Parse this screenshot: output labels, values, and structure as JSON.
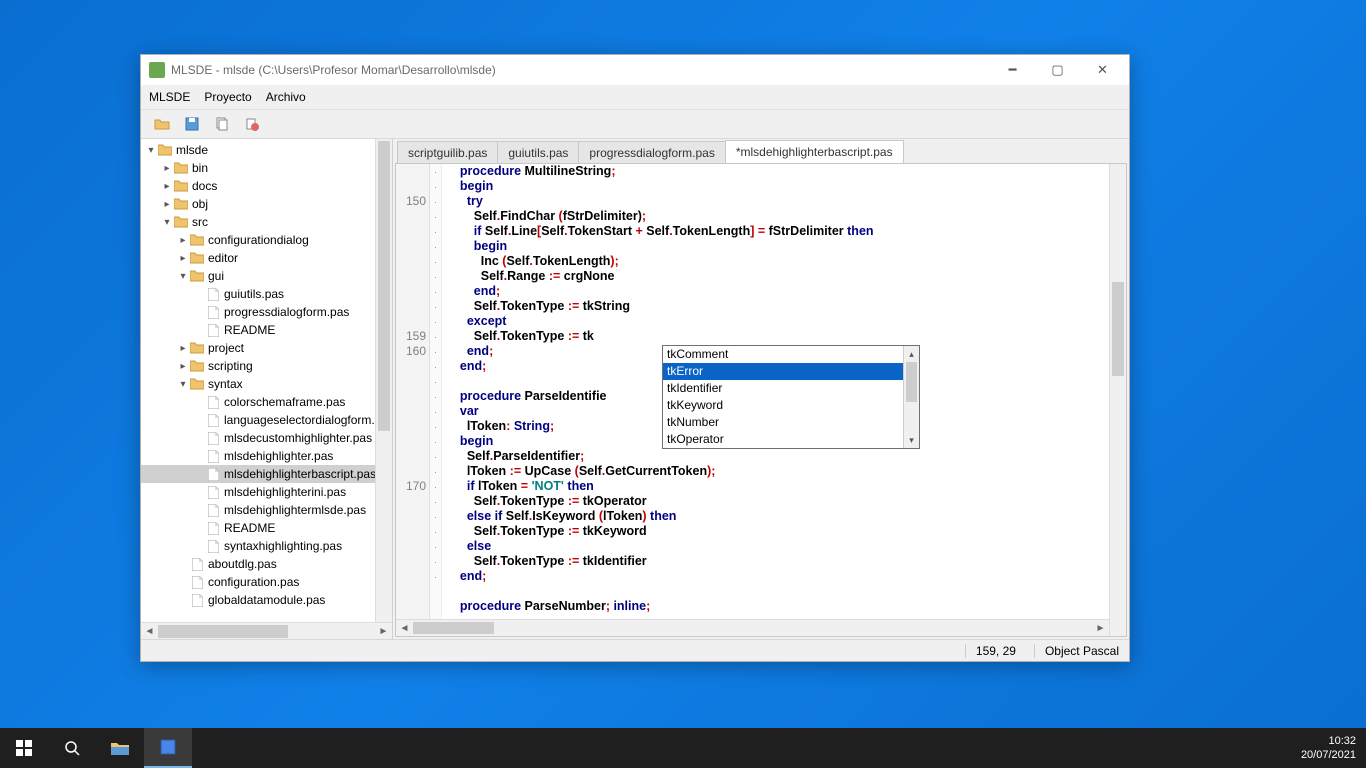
{
  "title": "MLSDE - mlsde (C:\\Users\\Profesor Momar\\Desarrollo\\mlsde)",
  "menus": [
    "MLSDE",
    "Proyecto",
    "Archivo"
  ],
  "tree": [
    {
      "d": 0,
      "t": "folder",
      "exp": "▾",
      "n": "mlsde"
    },
    {
      "d": 1,
      "t": "folder",
      "exp": "▸",
      "n": "bin"
    },
    {
      "d": 1,
      "t": "folder",
      "exp": "▸",
      "n": "docs"
    },
    {
      "d": 1,
      "t": "folder",
      "exp": "▸",
      "n": "obj"
    },
    {
      "d": 1,
      "t": "folder",
      "exp": "▾",
      "n": "src"
    },
    {
      "d": 2,
      "t": "folder",
      "exp": "▸",
      "n": "configurationdialog"
    },
    {
      "d": 2,
      "t": "folder",
      "exp": "▸",
      "n": "editor"
    },
    {
      "d": 2,
      "t": "folder",
      "exp": "▾",
      "n": "gui"
    },
    {
      "d": 3,
      "t": "file",
      "n": "guiutils.pas"
    },
    {
      "d": 3,
      "t": "file",
      "n": "progressdialogform.pas"
    },
    {
      "d": 3,
      "t": "file",
      "n": "README"
    },
    {
      "d": 2,
      "t": "folder",
      "exp": "▸",
      "n": "project"
    },
    {
      "d": 2,
      "t": "folder",
      "exp": "▸",
      "n": "scripting"
    },
    {
      "d": 2,
      "t": "folder",
      "exp": "▾",
      "n": "syntax"
    },
    {
      "d": 3,
      "t": "file",
      "n": "colorschemaframe.pas"
    },
    {
      "d": 3,
      "t": "file",
      "n": "languageselectordialogform.p"
    },
    {
      "d": 3,
      "t": "file",
      "n": "mlsdecustomhighlighter.pas"
    },
    {
      "d": 3,
      "t": "file",
      "n": "mlsdehighlighter.pas"
    },
    {
      "d": 3,
      "t": "file",
      "n": "mlsdehighlighterbascript.pas",
      "sel": true
    },
    {
      "d": 3,
      "t": "file",
      "n": "mlsdehighlighterini.pas"
    },
    {
      "d": 3,
      "t": "file",
      "n": "mlsdehighlightermlsde.pas"
    },
    {
      "d": 3,
      "t": "file",
      "n": "README"
    },
    {
      "d": 3,
      "t": "file",
      "n": "syntaxhighlighting.pas"
    },
    {
      "d": 2,
      "t": "file",
      "n": "aboutdlg.pas"
    },
    {
      "d": 2,
      "t": "file",
      "n": "configuration.pas"
    },
    {
      "d": 2,
      "t": "file",
      "n": "globaldatamodule.pas"
    }
  ],
  "tabs": [
    {
      "label": "scriptguilib.pas"
    },
    {
      "label": "guiutils.pas"
    },
    {
      "label": "progressdialogform.pas"
    },
    {
      "label": "*mlsdehighlighterbascript.pas",
      "active": true
    }
  ],
  "gutter": [
    "",
    "",
    "150",
    "",
    "",
    "",
    "",
    "",
    "",
    "",
    "",
    "159",
    "160",
    "",
    "",
    "",
    "",
    "",
    "",
    "",
    "",
    "170",
    "",
    "",
    "",
    "",
    "",
    ""
  ],
  "code_lines": [
    [
      [
        "    ",
        "sym"
      ],
      [
        "procedure ",
        "kw"
      ],
      [
        "MultilineString",
        "id"
      ],
      [
        ";",
        "sym"
      ]
    ],
    [
      [
        "    ",
        "sym"
      ],
      [
        "begin",
        "kw"
      ]
    ],
    [
      [
        "      ",
        "sym"
      ],
      [
        "try",
        "kw"
      ]
    ],
    [
      [
        "        Self",
        "id"
      ],
      [
        ".",
        "sym"
      ],
      [
        "FindChar ",
        "id"
      ],
      [
        "(",
        "sym"
      ],
      [
        "fStrDelimiter",
        "id"
      ],
      [
        ")",
        ";"
      ],
      [
        ";",
        "sym"
      ]
    ],
    [
      [
        "        ",
        "sym"
      ],
      [
        "if ",
        "kw"
      ],
      [
        "Self",
        "id"
      ],
      [
        ".",
        "sym"
      ],
      [
        "Line",
        "id"
      ],
      [
        "[",
        "sym"
      ],
      [
        "Self",
        "id"
      ],
      [
        ".",
        "sym"
      ],
      [
        "TokenStart ",
        "id"
      ],
      [
        "+ ",
        "sym"
      ],
      [
        "Self",
        "id"
      ],
      [
        ".",
        "sym"
      ],
      [
        "TokenLength",
        "id"
      ],
      [
        "] = ",
        "sym"
      ],
      [
        "fStrDelimiter ",
        "id"
      ],
      [
        "then",
        "kw"
      ]
    ],
    [
      [
        "        ",
        "sym"
      ],
      [
        "begin",
        "kw"
      ]
    ],
    [
      [
        "          Inc ",
        "id"
      ],
      [
        "(",
        "sym"
      ],
      [
        "Self",
        "id"
      ],
      [
        ".",
        "sym"
      ],
      [
        "TokenLength",
        "id"
      ],
      [
        ");",
        "sym"
      ]
    ],
    [
      [
        "          Self",
        "id"
      ],
      [
        ".",
        "sym"
      ],
      [
        "Range ",
        "id"
      ],
      [
        ":= ",
        "sym"
      ],
      [
        "crgNone",
        "id"
      ]
    ],
    [
      [
        "        ",
        "sym"
      ],
      [
        "end",
        "kw"
      ],
      [
        ";",
        "sym"
      ]
    ],
    [
      [
        "        Self",
        "id"
      ],
      [
        ".",
        "sym"
      ],
      [
        "TokenType ",
        "id"
      ],
      [
        ":= ",
        "sym"
      ],
      [
        "tkString",
        "id"
      ]
    ],
    [
      [
        "      ",
        "sym"
      ],
      [
        "except",
        "kw"
      ]
    ],
    [
      [
        "        Self",
        "id"
      ],
      [
        ".",
        "sym"
      ],
      [
        "TokenType ",
        "id"
      ],
      [
        ":= ",
        "sym"
      ],
      [
        "tk",
        "id"
      ]
    ],
    [
      [
        "      ",
        "sym"
      ],
      [
        "end",
        "kw"
      ],
      [
        ";",
        "sym"
      ]
    ],
    [
      [
        "    ",
        "sym"
      ],
      [
        "end",
        "kw"
      ],
      [
        ";",
        "sym"
      ]
    ],
    [
      [
        "",
        ""
      ]
    ],
    [
      [
        "    ",
        "sym"
      ],
      [
        "procedure ",
        "kw"
      ],
      [
        "ParseIdentifie",
        "id"
      ]
    ],
    [
      [
        "    ",
        "sym"
      ],
      [
        "var",
        "kw"
      ]
    ],
    [
      [
        "      lToken",
        "id"
      ],
      [
        ": ",
        "sym"
      ],
      [
        "String",
        "kw"
      ],
      [
        ";",
        "sym"
      ]
    ],
    [
      [
        "    ",
        "sym"
      ],
      [
        "begin",
        "kw"
      ]
    ],
    [
      [
        "      Self",
        "id"
      ],
      [
        ".",
        "sym"
      ],
      [
        "ParseIdentifier",
        "id"
      ],
      [
        ";",
        "sym"
      ]
    ],
    [
      [
        "      lToken ",
        "id"
      ],
      [
        ":= ",
        "sym"
      ],
      [
        "UpCase ",
        "id"
      ],
      [
        "(",
        "sym"
      ],
      [
        "Self",
        "id"
      ],
      [
        ".",
        "sym"
      ],
      [
        "GetCurrentToken",
        "id"
      ],
      [
        ");",
        "sym"
      ]
    ],
    [
      [
        "      ",
        "sym"
      ],
      [
        "if ",
        "kw"
      ],
      [
        "lToken ",
        "id"
      ],
      [
        "= ",
        "sym"
      ],
      [
        "'NOT'",
        "str"
      ],
      [
        " ",
        "sym"
      ],
      [
        "then",
        "kw"
      ]
    ],
    [
      [
        "        Self",
        "id"
      ],
      [
        ".",
        "sym"
      ],
      [
        "TokenType ",
        "id"
      ],
      [
        ":= ",
        "sym"
      ],
      [
        "tkOperator",
        "id"
      ]
    ],
    [
      [
        "      ",
        "sym"
      ],
      [
        "else if ",
        "kw"
      ],
      [
        "Self",
        "id"
      ],
      [
        ".",
        "sym"
      ],
      [
        "IsKeyword ",
        "id"
      ],
      [
        "(",
        "sym"
      ],
      [
        "lToken",
        "id"
      ],
      [
        ") ",
        "sym"
      ],
      [
        "then",
        "kw"
      ]
    ],
    [
      [
        "        Self",
        "id"
      ],
      [
        ".",
        "sym"
      ],
      [
        "TokenType ",
        "id"
      ],
      [
        ":= ",
        "sym"
      ],
      [
        "tkKeyword",
        "id"
      ]
    ],
    [
      [
        "      ",
        "sym"
      ],
      [
        "else",
        "kw"
      ]
    ],
    [
      [
        "        Self",
        "id"
      ],
      [
        ".",
        "sym"
      ],
      [
        "TokenType ",
        "id"
      ],
      [
        ":= ",
        "sym"
      ],
      [
        "tkIdentifier",
        "id"
      ]
    ],
    [
      [
        "    ",
        "sym"
      ],
      [
        "end",
        "kw"
      ],
      [
        ";",
        "sym"
      ]
    ],
    [
      [
        "",
        ""
      ]
    ],
    [
      [
        "    ",
        "sym"
      ],
      [
        "procedure ",
        "kw"
      ],
      [
        "ParseNumber",
        "id"
      ],
      [
        "; ",
        "sym"
      ],
      [
        "inline",
        "kw"
      ],
      [
        ";",
        "sym"
      ]
    ]
  ],
  "autocomplete": {
    "items": [
      "tkComment",
      "tkError",
      "tkIdentifier",
      "tkKeyword",
      "tkNumber",
      "tkOperator"
    ],
    "selected": 1
  },
  "status": {
    "pos": "159, 29",
    "lang": "Object Pascal"
  },
  "taskbar": {
    "time": "10:32",
    "date": "20/07/2021"
  }
}
